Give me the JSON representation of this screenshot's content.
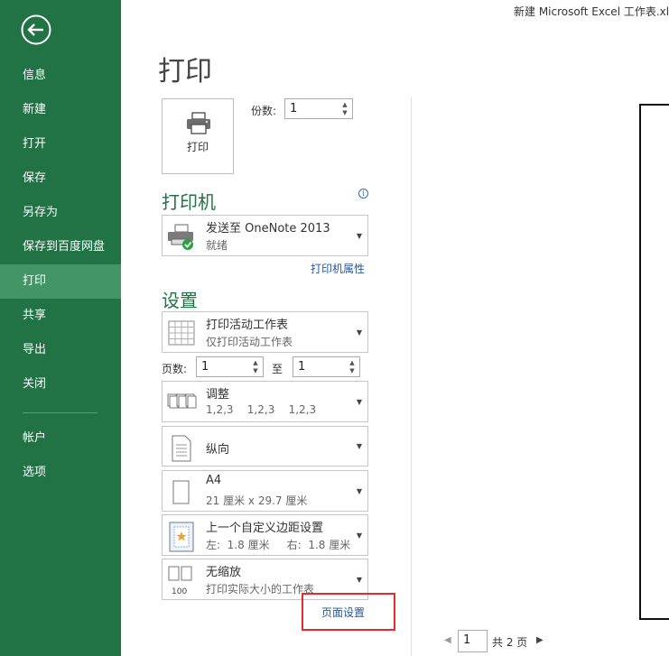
{
  "window": {
    "title": "新建 Microsoft Excel 工作表.xlsx"
  },
  "sidebar": {
    "items": [
      {
        "label": "信息"
      },
      {
        "label": "新建"
      },
      {
        "label": "打开"
      },
      {
        "label": "保存"
      },
      {
        "label": "另存为"
      },
      {
        "label": "保存到百度网盘"
      },
      {
        "label": "打印",
        "active": true
      },
      {
        "label": "共享"
      },
      {
        "label": "导出"
      },
      {
        "label": "关闭"
      },
      {
        "label": "帐户"
      },
      {
        "label": "选项"
      }
    ]
  },
  "main": {
    "title": "打印",
    "print_button": "打印",
    "copies": {
      "label": "份数:",
      "value": "1"
    },
    "printer": {
      "section_title": "打印机",
      "name": "发送至 OneNote 2013",
      "status": "就绪",
      "properties_link": "打印机属性"
    },
    "settings": {
      "section_title": "设置",
      "scope": {
        "main": "打印活动工作表",
        "sub": "仅打印活动工作表"
      },
      "pages": {
        "label": "页数:",
        "from": "1",
        "to_label": "至",
        "to": "1"
      },
      "collate": {
        "main": "调整",
        "sub": "1,2,3    1,2,3    1,2,3"
      },
      "orientation": {
        "main": "纵向"
      },
      "paper": {
        "main": "A4",
        "sub": "21 厘米 x 29.7 厘米"
      },
      "margins": {
        "main": "上一个自定义边距设置",
        "sub": "左:  1.8 厘米     右:  1.8 厘米"
      },
      "scaling": {
        "main": "无缩放",
        "sub": "打印实际大小的工作表"
      },
      "page_setup_link": "页面设置"
    }
  },
  "preview": {
    "current_page": "1",
    "total_label": "共 2 页"
  },
  "colors": {
    "accent": "#217346",
    "active_nav": "#439467",
    "link": "#2b579a",
    "highlight": "#e8292e"
  }
}
